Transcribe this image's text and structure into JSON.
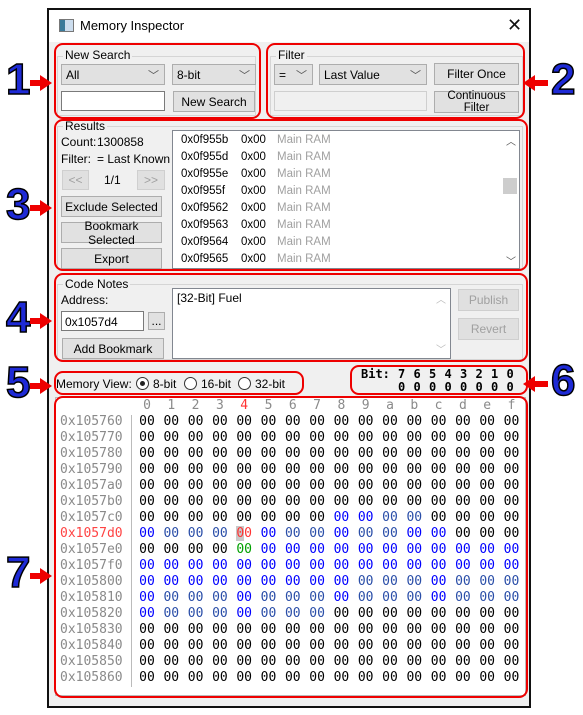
{
  "window": {
    "title": "Memory Inspector",
    "close_icon": "close-icon"
  },
  "annotations": [
    "1",
    "2",
    "3",
    "4",
    "5",
    "6",
    "7"
  ],
  "new_search": {
    "label": "New Search",
    "scope": "All",
    "size": "8-bit",
    "value": "",
    "button": "New Search"
  },
  "filter": {
    "label": "Filter",
    "operator": "=",
    "compare": "Last Value",
    "value": "",
    "filter_once": "Filter Once",
    "continuous": "Continuous Filter"
  },
  "results": {
    "label": "Results",
    "count_label": "Count:",
    "count": "1300858",
    "filter_label": "Filter:",
    "filter_value": "= Last Known",
    "prev": "<<",
    "page": "1/1",
    "next": ">>",
    "exclude": "Exclude Selected",
    "bookmark": "Bookmark Selected",
    "export": "Export",
    "rows": [
      {
        "address": "0x0f955b",
        "value": "0x00",
        "region": "Main RAM"
      },
      {
        "address": "0x0f955d",
        "value": "0x00",
        "region": "Main RAM"
      },
      {
        "address": "0x0f955e",
        "value": "0x00",
        "region": "Main RAM"
      },
      {
        "address": "0x0f955f",
        "value": "0x00",
        "region": "Main RAM"
      },
      {
        "address": "0x0f9562",
        "value": "0x00",
        "region": "Main RAM"
      },
      {
        "address": "0x0f9563",
        "value": "0x00",
        "region": "Main RAM"
      },
      {
        "address": "0x0f9564",
        "value": "0x00",
        "region": "Main RAM"
      },
      {
        "address": "0x0f9565",
        "value": "0x00",
        "region": "Main RAM"
      }
    ]
  },
  "code_notes": {
    "label": "Code Notes",
    "address_label": "Address:",
    "address": "0x1057d4",
    "browse": "...",
    "add_bookmark": "Add Bookmark",
    "note": "[32-Bit] Fuel",
    "publish": "Publish",
    "revert": "Revert"
  },
  "memory_view": {
    "label": "Memory View:",
    "options": [
      "8-bit",
      "16-bit",
      "32-bit"
    ],
    "selected": "8-bit"
  },
  "bits": {
    "label": "Bit:",
    "positions": [
      "7",
      "6",
      "5",
      "4",
      "3",
      "2",
      "1",
      "0"
    ],
    "values": [
      "0",
      "0",
      "0",
      "0",
      "0",
      "0",
      "0",
      "0"
    ]
  },
  "hex": {
    "columns": [
      "0",
      "1",
      "2",
      "3",
      "4",
      "5",
      "6",
      "7",
      "8",
      "9",
      "a",
      "b",
      "c",
      "d",
      "e",
      "f"
    ],
    "highlight_column": 4,
    "selected_row": "0x1057d0",
    "colors": {
      "k": "#000000",
      "b": "#0000ff",
      "d": "#2a4ea8",
      "r": "#ff3333",
      "g": "#00a000",
      "addr": "#8a8a8a",
      "sel_addr": "#ff4444"
    },
    "rows": [
      {
        "address": "0x105760",
        "values": [
          "00",
          "00",
          "00",
          "00",
          "00",
          "00",
          "00",
          "00",
          "00",
          "00",
          "00",
          "00",
          "00",
          "00",
          "00",
          "00"
        ],
        "colors": "kkkkkkkkkkkkkkkk"
      },
      {
        "address": "0x105770",
        "values": [
          "00",
          "00",
          "00",
          "00",
          "00",
          "00",
          "00",
          "00",
          "00",
          "00",
          "00",
          "00",
          "00",
          "00",
          "00",
          "00"
        ],
        "colors": "kkkkkkkkkkkkkkkk"
      },
      {
        "address": "0x105780",
        "values": [
          "00",
          "00",
          "00",
          "00",
          "00",
          "00",
          "00",
          "00",
          "00",
          "00",
          "00",
          "00",
          "00",
          "00",
          "00",
          "00"
        ],
        "colors": "kkkkkkkkkkkkkkkk"
      },
      {
        "address": "0x105790",
        "values": [
          "00",
          "00",
          "00",
          "00",
          "00",
          "00",
          "00",
          "00",
          "00",
          "00",
          "00",
          "00",
          "00",
          "00",
          "00",
          "00"
        ],
        "colors": "kkkkkkkkkkkkkkkk"
      },
      {
        "address": "0x1057a0",
        "values": [
          "00",
          "00",
          "00",
          "00",
          "00",
          "00",
          "00",
          "00",
          "00",
          "00",
          "00",
          "00",
          "00",
          "00",
          "00",
          "00"
        ],
        "colors": "kkkkkkkkkkkkkkkk"
      },
      {
        "address": "0x1057b0",
        "values": [
          "00",
          "00",
          "00",
          "00",
          "00",
          "00",
          "00",
          "00",
          "00",
          "00",
          "00",
          "00",
          "00",
          "00",
          "00",
          "00"
        ],
        "colors": "kkkkkkkkkkkkkkkk"
      },
      {
        "address": "0x1057c0",
        "values": [
          "00",
          "00",
          "00",
          "00",
          "00",
          "00",
          "00",
          "00",
          "00",
          "00",
          "00",
          "00",
          "00",
          "00",
          "00",
          "00"
        ],
        "colors": "kkkkkkkkbbddkkkk"
      },
      {
        "address": "0x1057d0",
        "values": [
          "00",
          "00",
          "00",
          "00",
          "00",
          "00",
          "00",
          "00",
          "00",
          "00",
          "00",
          "00",
          "00",
          "00",
          "00",
          "00"
        ],
        "colors": "bdddrbddbddbbkkk"
      },
      {
        "address": "0x1057e0",
        "values": [
          "00",
          "00",
          "00",
          "00",
          "00",
          "00",
          "00",
          "00",
          "00",
          "00",
          "00",
          "00",
          "00",
          "00",
          "00",
          "00"
        ],
        "colors": "kkkkgbbbbbbbbbbb"
      },
      {
        "address": "0x1057f0",
        "values": [
          "00",
          "00",
          "00",
          "00",
          "00",
          "00",
          "00",
          "00",
          "00",
          "00",
          "00",
          "00",
          "00",
          "00",
          "00",
          "00"
        ],
        "colors": "bbbbbbbbbbbbbbbb"
      },
      {
        "address": "0x105800",
        "values": [
          "00",
          "00",
          "00",
          "00",
          "00",
          "00",
          "00",
          "00",
          "00",
          "00",
          "00",
          "00",
          "00",
          "00",
          "00",
          "00"
        ],
        "colors": "bbbbbbbbbdddbddd"
      },
      {
        "address": "0x105810",
        "values": [
          "00",
          "00",
          "00",
          "00",
          "00",
          "00",
          "00",
          "00",
          "00",
          "00",
          "00",
          "00",
          "00",
          "00",
          "00",
          "00"
        ],
        "colors": "bdddbdddbdddbddd"
      },
      {
        "address": "0x105820",
        "values": [
          "00",
          "00",
          "00",
          "00",
          "00",
          "00",
          "00",
          "00",
          "00",
          "00",
          "00",
          "00",
          "00",
          "00",
          "00",
          "00"
        ],
        "colors": "bdddbdddkkkkkkkk"
      },
      {
        "address": "0x105830",
        "values": [
          "00",
          "00",
          "00",
          "00",
          "00",
          "00",
          "00",
          "00",
          "00",
          "00",
          "00",
          "00",
          "00",
          "00",
          "00",
          "00"
        ],
        "colors": "kkkkkkkkkkkkkkkk"
      },
      {
        "address": "0x105840",
        "values": [
          "00",
          "00",
          "00",
          "00",
          "00",
          "00",
          "00",
          "00",
          "00",
          "00",
          "00",
          "00",
          "00",
          "00",
          "00",
          "00"
        ],
        "colors": "kkkkkkkkkkkkkkkk"
      },
      {
        "address": "0x105850",
        "values": [
          "00",
          "00",
          "00",
          "00",
          "00",
          "00",
          "00",
          "00",
          "00",
          "00",
          "00",
          "00",
          "00",
          "00",
          "00",
          "00"
        ],
        "colors": "kkkkkkkkkkkkkkkk"
      },
      {
        "address": "0x105860",
        "values": [
          "00",
          "00",
          "00",
          "00",
          "00",
          "00",
          "00",
          "00",
          "00",
          "00",
          "00",
          "00",
          "00",
          "00",
          "00",
          "00"
        ],
        "colors": "kkkkkkkkkkkkkkkk"
      }
    ]
  }
}
